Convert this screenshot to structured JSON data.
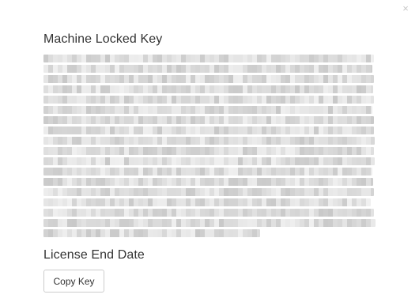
{
  "dialog": {
    "close_label": "×",
    "key_title": "Machine Locked Key",
    "key_value_state": "obscured",
    "end_date_title": "License End Date",
    "copy_button_label": "Copy Key"
  }
}
